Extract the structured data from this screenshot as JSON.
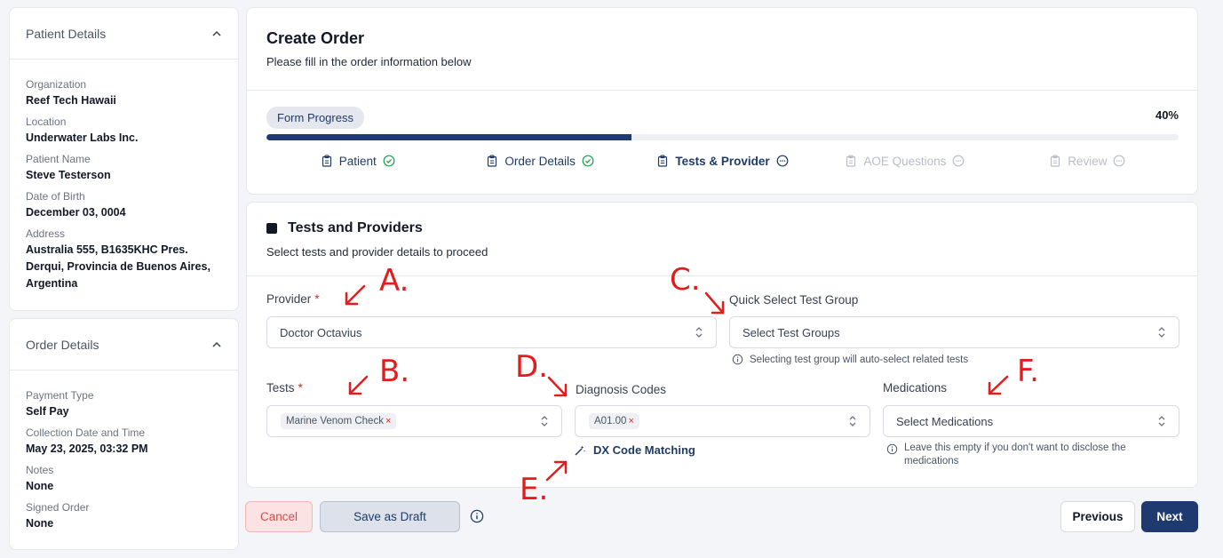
{
  "patient_details": {
    "title": "Patient Details",
    "fields": [
      {
        "label": "Organization",
        "value": "Reef Tech Hawaii"
      },
      {
        "label": "Location",
        "value": "Underwater Labs Inc."
      },
      {
        "label": "Patient Name",
        "value": "Steve Testerson"
      },
      {
        "label": "Date of Birth",
        "value": "December 03, 0004"
      },
      {
        "label": "Address",
        "value": "Australia 555, B1635KHC Pres. Derqui, Provincia de Buenos Aires, Argentina"
      }
    ]
  },
  "order_details": {
    "title": "Order Details",
    "fields": [
      {
        "label": "Payment Type",
        "value": "Self Pay"
      },
      {
        "label": "Collection Date and Time",
        "value": "May 23, 2025, 03:32 PM"
      },
      {
        "label": "Notes",
        "value": "None"
      },
      {
        "label": "Signed Order",
        "value": "None"
      }
    ]
  },
  "header": {
    "title": "Create Order",
    "subtitle": "Please fill in the order information below",
    "progress_label": "Form Progress",
    "progress_percent_text": "40%",
    "progress_fraction": 0.4,
    "steps": [
      {
        "label": "Patient",
        "state": "done"
      },
      {
        "label": "Order Details",
        "state": "done"
      },
      {
        "label": "Tests & Provider",
        "state": "current"
      },
      {
        "label": "AOE Questions",
        "state": "pending"
      },
      {
        "label": "Review",
        "state": "pending"
      }
    ]
  },
  "tests": {
    "title": "Tests and Providers",
    "subtitle": "Select tests and provider details to proceed",
    "provider_label": "Provider",
    "required_mark": "*",
    "provider_value": "Doctor Octavius",
    "quick_label": "Quick Select Test Group",
    "quick_placeholder": "Select Test Groups",
    "quick_hint": "Selecting test group will auto-select related tests",
    "tests_label": "Tests",
    "tests_chip": "Marine Venom Check",
    "chip_remove": "×",
    "dx_label": "Diagnosis Codes",
    "dx_chip": "A01.00",
    "dx_matching": "DX Code Matching",
    "med_label": "Medications",
    "med_placeholder": "Select Medications",
    "med_hint": "Leave this empty if you don't want to disclose the medications"
  },
  "footer": {
    "cancel": "Cancel",
    "save_draft": "Save as Draft",
    "previous": "Previous",
    "next": "Next"
  },
  "annotations": [
    "A.",
    "B.",
    "C.",
    "D.",
    "E.",
    "F."
  ],
  "colors": {
    "accent": "#1e3a6e",
    "success": "#16a34a",
    "danger": "#dc2626",
    "annotation": "#e11d1d"
  },
  "icons": {
    "collapse": "chevron-up-icon",
    "step": "clipboard-icon",
    "done": "check-circle-icon",
    "pending": "dots-circle-icon",
    "select": "updown-icon",
    "info": "info-icon",
    "dx": "magic-wand-icon"
  }
}
